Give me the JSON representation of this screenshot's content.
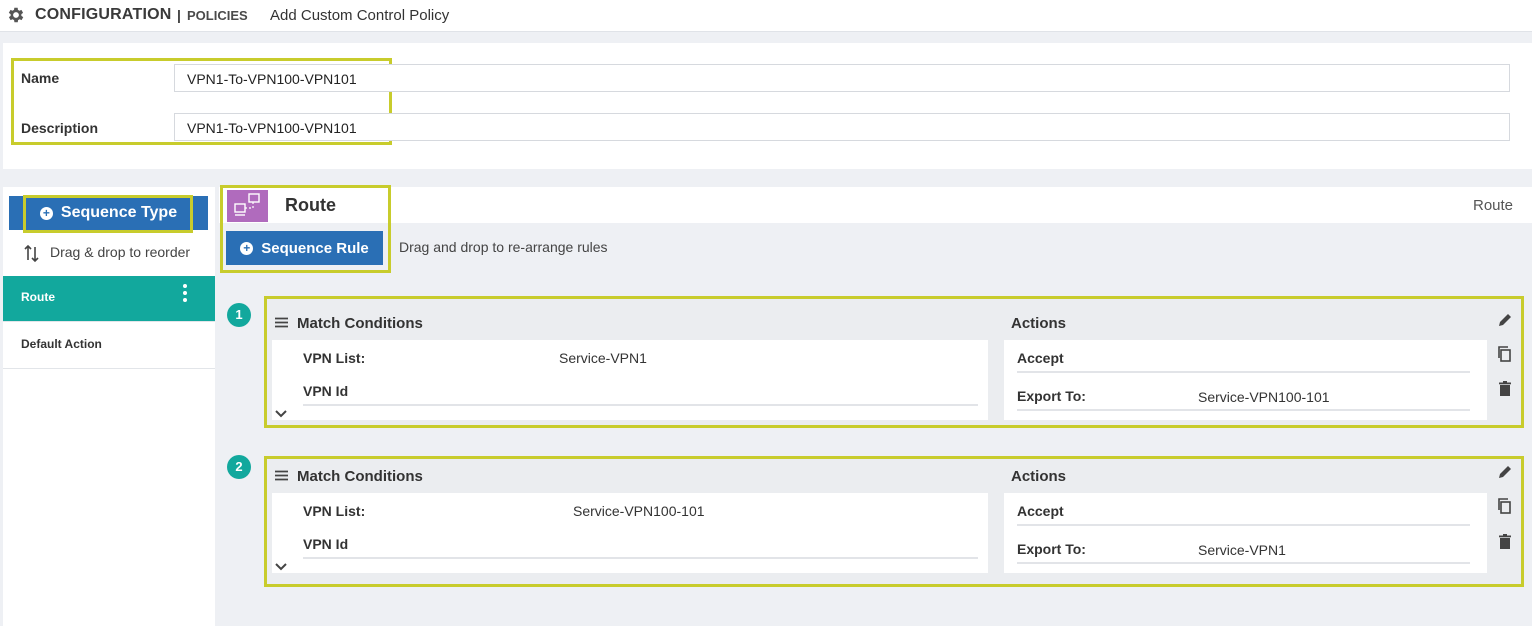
{
  "header": {
    "section": "CONFIGURATION",
    "separator": "|",
    "subsection": "POLICIES",
    "page_title": "Add Custom Control Policy"
  },
  "form": {
    "name_label": "Name",
    "name_value": "VPN1-To-VPN100-VPN101",
    "description_label": "Description",
    "description_value": "VPN1-To-VPN100-VPN101"
  },
  "sidebar": {
    "sequence_type_label": "Sequence Type",
    "reorder_label": "Drag & drop to reorder",
    "items": [
      {
        "label": "Route"
      },
      {
        "label": "Default Action"
      }
    ]
  },
  "main": {
    "route_title": "Route",
    "route_right_label": "Route",
    "sequence_rule_label": "Sequence Rule",
    "drag_hint": "Drag and drop to re-arrange rules"
  },
  "rules": [
    {
      "number": "1",
      "match_title": "Match Conditions",
      "actions_title": "Actions",
      "vpn_list_label": "VPN List:",
      "vpn_list_value": "Service-VPN1",
      "vpn_id_label": "VPN Id",
      "accept_label": "Accept",
      "export_label": "Export To:",
      "export_value": "Service-VPN100-101"
    },
    {
      "number": "2",
      "match_title": "Match Conditions",
      "actions_title": "Actions",
      "vpn_list_label": "VPN List:",
      "vpn_list_value": "Service-VPN100-101",
      "vpn_id_label": "VPN Id",
      "accept_label": "Accept",
      "export_label": "Export To:",
      "export_value": "Service-VPN1"
    }
  ],
  "colors": {
    "teal": "#12a89d",
    "blue": "#2a6fb5",
    "highlight": "#c8cc2c",
    "route_icon": "#b06bbd"
  },
  "icons": [
    "gear-icon",
    "plus-circle-icon",
    "reorder-arrows-icon",
    "kebab-icon",
    "route-icon",
    "hamburger-icon",
    "chevron-down-icon",
    "edit-icon",
    "copy-icon",
    "delete-icon"
  ]
}
